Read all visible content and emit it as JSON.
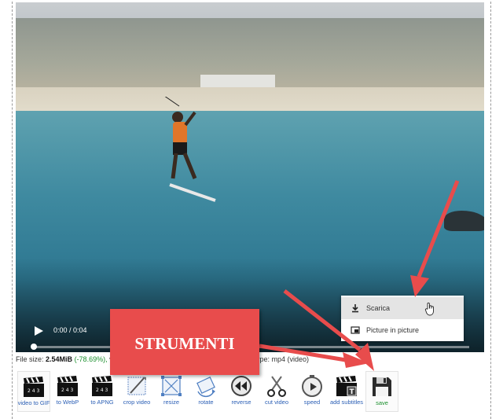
{
  "video": {
    "time": "0:00 / 0:04",
    "progress": 0.0
  },
  "context_menu": {
    "items": [
      {
        "label": "Scarica",
        "icon": "download-icon",
        "highlighted": true
      },
      {
        "label": "Picture in picture",
        "icon": "picture-in-picture-icon",
        "highlighted": false
      }
    ]
  },
  "file_info": {
    "size_label": "File size:",
    "size_value": "2.54MiB",
    "size_change": "(-78.69%),",
    "size_after": " v",
    "type_text": "ype: mp4 (video)"
  },
  "toolbar": {
    "tools": [
      {
        "label": "video to GIF",
        "icon": "clapperboard-icon"
      },
      {
        "label": "to WebP",
        "icon": "clapperboard-icon"
      },
      {
        "label": "to APNG",
        "icon": "clapperboard-icon"
      },
      {
        "label": "crop video",
        "icon": "crop-icon"
      },
      {
        "label": "resize",
        "icon": "resize-icon"
      },
      {
        "label": "rotate",
        "icon": "rotate-icon"
      },
      {
        "label": "reverse",
        "icon": "reverse-icon"
      },
      {
        "label": "cut video",
        "icon": "scissors-icon"
      },
      {
        "label": "speed",
        "icon": "speed-icon"
      },
      {
        "label": "add subtitles",
        "icon": "subtitles-icon"
      },
      {
        "label": "save",
        "icon": "save-icon"
      }
    ]
  },
  "annotation": {
    "callout_text": "STRUMENTI",
    "color": "#e84c4c"
  }
}
